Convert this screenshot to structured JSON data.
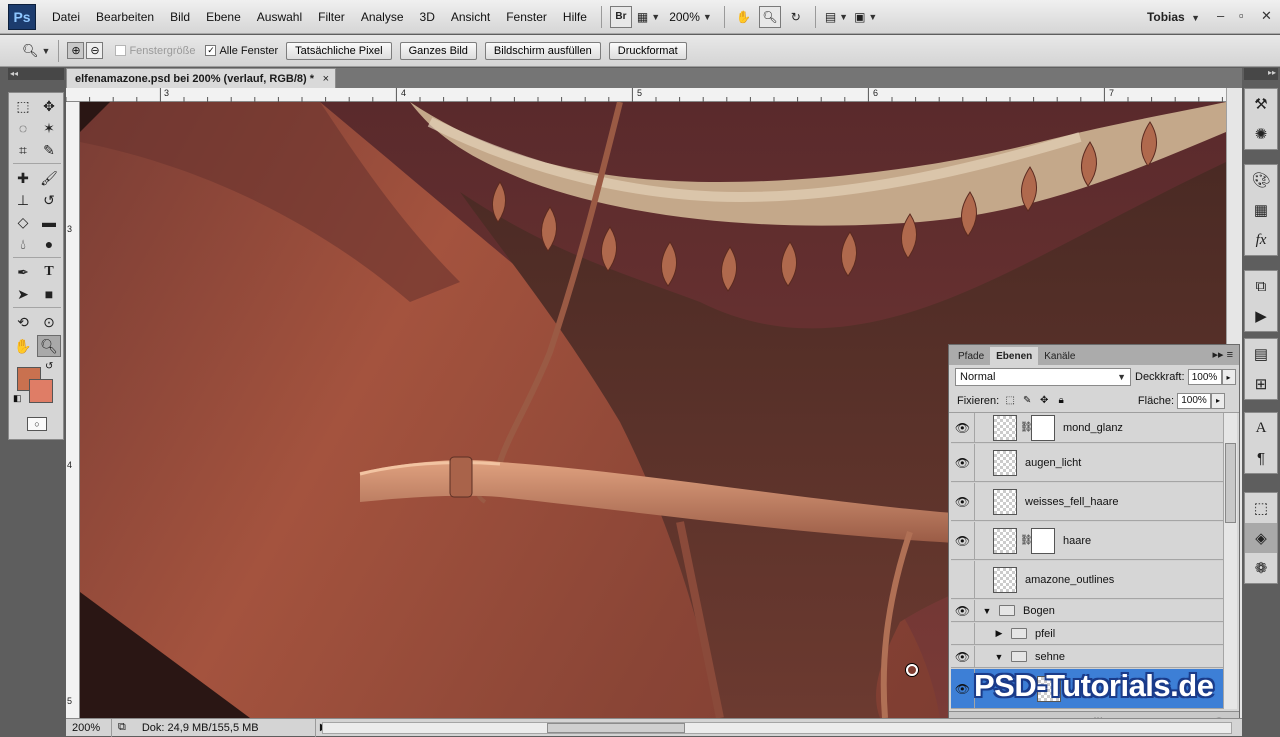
{
  "app": {
    "logo": "Ps",
    "user": "Tobias"
  },
  "menu": [
    "Datei",
    "Bearbeiten",
    "Bild",
    "Ebene",
    "Auswahl",
    "Filter",
    "Analyse",
    "3D",
    "Ansicht",
    "Fenster",
    "Hilfe"
  ],
  "menubar_tools": {
    "bridge": "Br",
    "zoom_level": "200%"
  },
  "options": {
    "fenstergroesse": "Fenstergröße",
    "alle_fenster": "Alle Fenster",
    "buttons": [
      "Tatsächliche Pixel",
      "Ganzes Bild",
      "Bildschirm ausfüllen",
      "Druckformat"
    ]
  },
  "document": {
    "tab_title": "elfenamazone.psd bei 200% (verlauf, RGB/8) *",
    "close": "×"
  },
  "rulers": {
    "top": [
      "3",
      "4",
      "5",
      "6",
      "7"
    ],
    "left": [
      "3",
      "4",
      "5"
    ]
  },
  "status": {
    "zoom": "200%",
    "doc_info": "Dok: 24,9 MB/155,5 MB"
  },
  "colors": {
    "foreground": "#c9714f",
    "background": "#df7d66",
    "selection": "#3d7fd6"
  },
  "layers_panel": {
    "tabs": [
      "Pfade",
      "Ebenen",
      "Kanäle"
    ],
    "active_tab": "Ebenen",
    "blend_mode": "Normal",
    "opacity_label": "Deckkraft:",
    "opacity": "100%",
    "lock_label": "Fixieren:",
    "fill_label": "Fläche:",
    "fill": "100%",
    "layers": [
      {
        "name": "mond_glanz",
        "visible": true,
        "mask": true
      },
      {
        "name": "augen_licht",
        "visible": true,
        "mask": false
      },
      {
        "name": "weisses_fell_haare",
        "visible": true,
        "mask": false
      },
      {
        "name": "haare",
        "visible": true,
        "mask": true
      },
      {
        "name": "amazone_outlines",
        "visible": false,
        "mask": false
      },
      {
        "name": "Bogen",
        "visible": true,
        "group": true,
        "expanded": true
      },
      {
        "name": "pfeil",
        "visible": false,
        "group": true,
        "expanded": false
      },
      {
        "name": "sehne",
        "visible": true,
        "group": true,
        "expanded": true
      }
    ]
  },
  "watermark": "PSD-Tutorials.de"
}
